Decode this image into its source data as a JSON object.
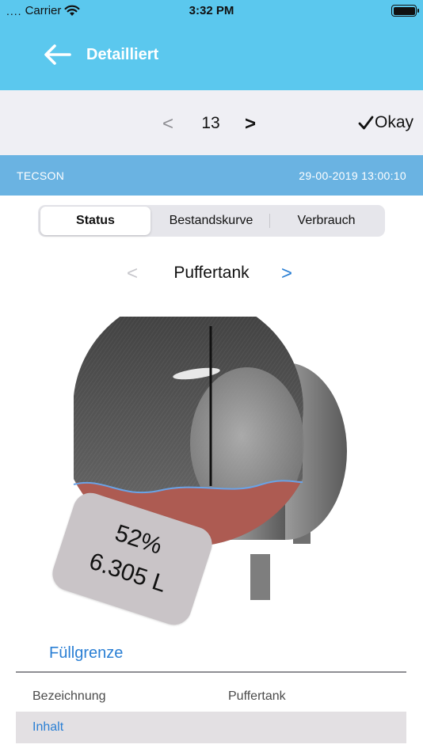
{
  "status_bar": {
    "signal_dots": "....",
    "carrier": "Carrier",
    "time": "3:32 PM",
    "icons": [
      "wifi-icon",
      "battery-icon"
    ]
  },
  "nav": {
    "title": "Detailliert",
    "back_icon": "arrow-left-icon"
  },
  "pager": {
    "prev": "<",
    "number": "13",
    "next": ">",
    "okay_label": "Okay",
    "okay_icon": "checkmark-icon"
  },
  "info": {
    "brand": "TECSON",
    "timestamp": "29-00-2019 13:00:10"
  },
  "segments": {
    "items": [
      "Status",
      "Bestandskurve",
      "Verbrauch"
    ],
    "selected": "Status"
  },
  "tank_selector": {
    "prev": "<",
    "name": "Puffertank",
    "next": ">"
  },
  "tank_level": {
    "percent_label": "52%",
    "volume_label": "6.305 L",
    "fill_fraction": 0.52
  },
  "colors": {
    "header_blue": "#5bc8ee",
    "info_blue": "#6ab3e2",
    "liquid_red": "#ad5b52",
    "accent_blue": "#2a7fd4"
  },
  "details": {
    "section_title": "Füllgrenze",
    "rows": [
      {
        "label": "Bezeichnung",
        "value": "Puffertank"
      },
      {
        "label": "Inhalt",
        "value": ""
      }
    ]
  }
}
